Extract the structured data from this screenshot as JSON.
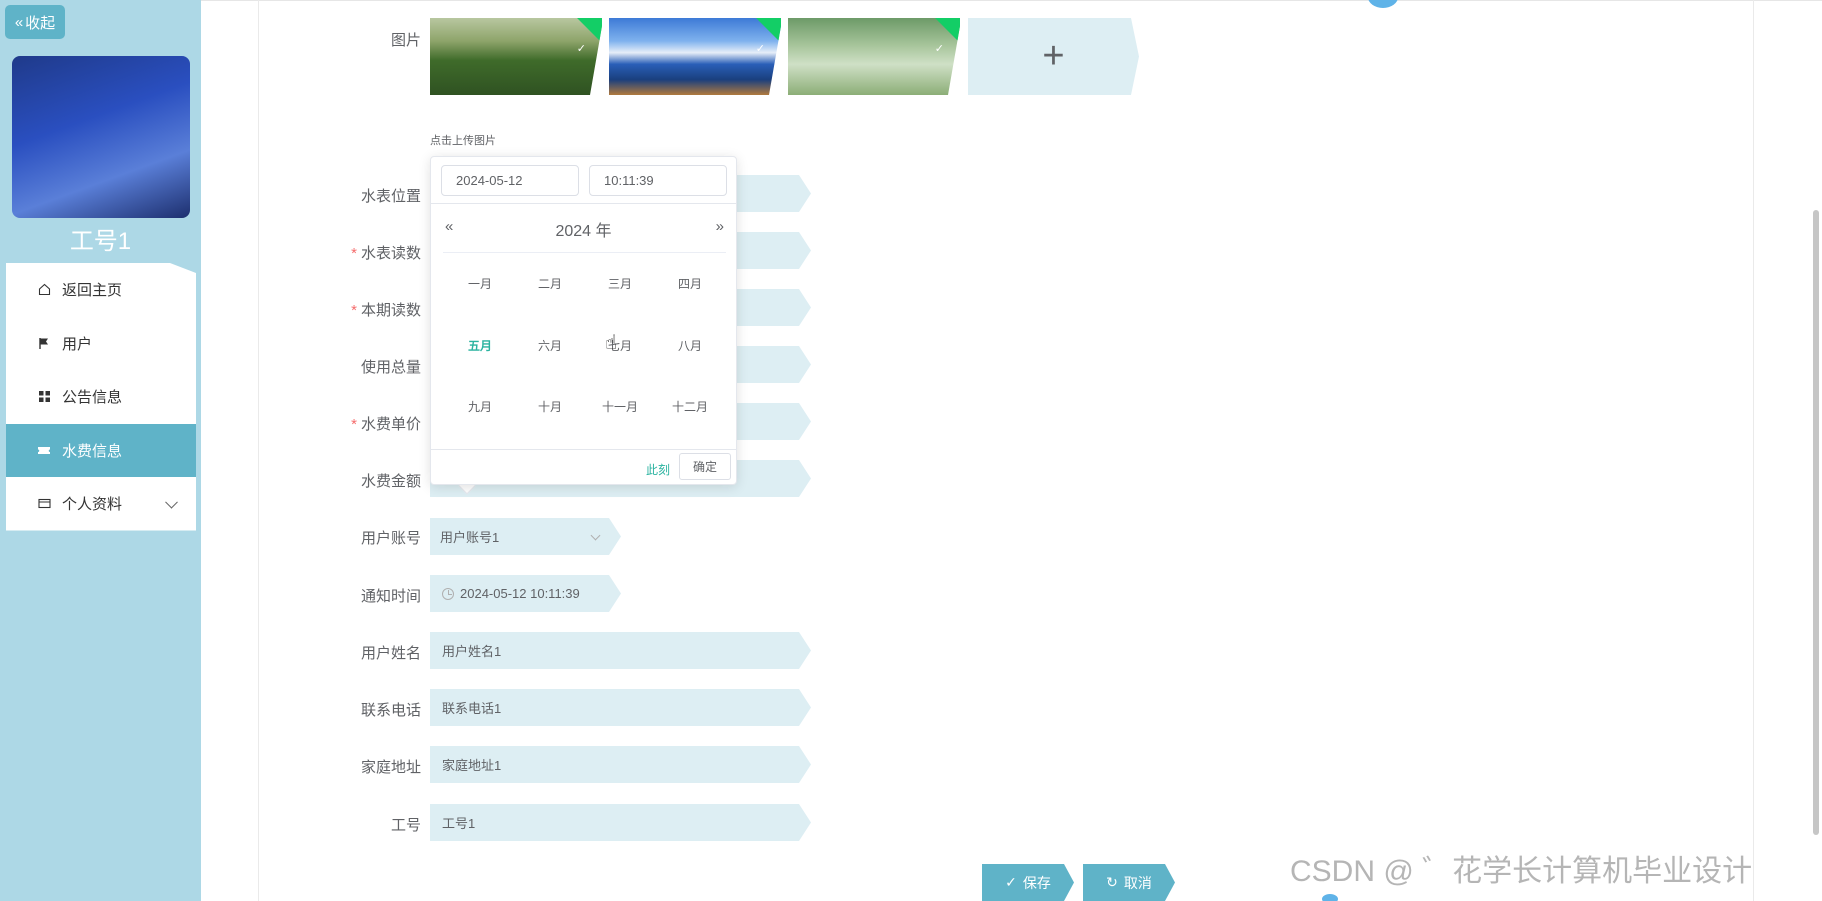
{
  "sidebar": {
    "collapse_label": "收起",
    "username": "工号1",
    "items": [
      {
        "label": "返回主页",
        "icon": "home-icon"
      },
      {
        "label": "用户",
        "icon": "flag-icon"
      },
      {
        "label": "公告信息",
        "icon": "grid-icon"
      },
      {
        "label": "水费信息",
        "icon": "ticket-icon"
      },
      {
        "label": "个人资料",
        "icon": "wallet-icon"
      }
    ],
    "active_index": 3
  },
  "form": {
    "image_label": "图片",
    "upload_hint": "点击上传图片",
    "labels": {
      "meter_location": "水表位置",
      "meter_reading": "水表读数",
      "current_reading": "本期读数",
      "total_usage": "使用总量",
      "unit_price": "水费单价",
      "amount": "水费金额",
      "user_account": "用户账号",
      "notify_time": "通知时间",
      "user_name": "用户姓名",
      "phone": "联系电话",
      "address": "家庭地址",
      "employee_no": "工号"
    },
    "values": {
      "user_account": "用户账号1",
      "notify_time": "2024-05-12 10:11:39",
      "user_name": "用户姓名1",
      "phone": "联系电话1",
      "address": "家庭地址1",
      "employee_no": "工号1"
    }
  },
  "datepicker": {
    "date_value": "2024-05-12",
    "time_value": "10:11:39",
    "prev": "«",
    "next": "»",
    "year_label": "2024 年",
    "months": [
      "一月",
      "二月",
      "三月",
      "四月",
      "五月",
      "六月",
      "七月",
      "八月",
      "九月",
      "十月",
      "十一月",
      "十二月"
    ],
    "current_month_index": 4,
    "now_label": "此刻",
    "ok_label": "确定"
  },
  "buttons": {
    "save": "保存",
    "cancel": "取消"
  },
  "watermark": "CSDN @ ゛花学长计算机毕业设计"
}
